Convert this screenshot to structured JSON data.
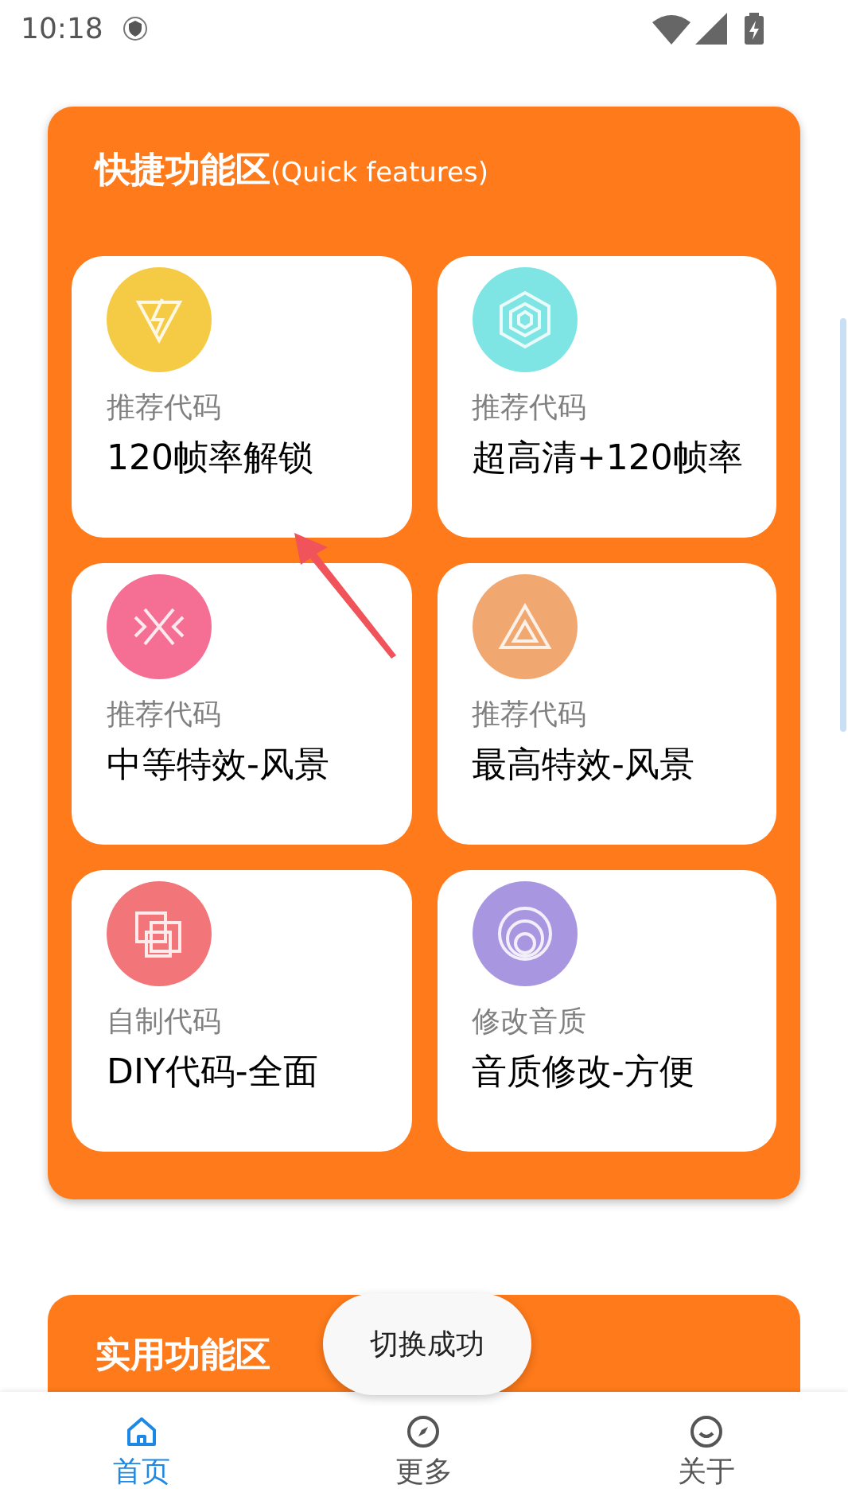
{
  "status_bar": {
    "time": "10:18"
  },
  "quick_section": {
    "title": "快捷功能区",
    "subtitle": "(Quick features)",
    "tiles": [
      {
        "kind": "bolt",
        "color": "#f5cb45",
        "label": "推荐代码",
        "title": "120帧率解锁"
      },
      {
        "kind": "hexagon",
        "color": "#7ee5e4",
        "label": "推荐代码",
        "title": "超高清+120帧率"
      },
      {
        "kind": "cross",
        "color": "#f56e94",
        "label": "推荐代码",
        "title": "中等特效-风景"
      },
      {
        "kind": "triangle",
        "color": "#f0a770",
        "label": "推荐代码",
        "title": "最高特效-风景"
      },
      {
        "kind": "squares",
        "color": "#f27679",
        "label": "自制代码",
        "title": "DIY代码-全面"
      },
      {
        "kind": "rings",
        "color": "#a996e0",
        "label": "修改音质",
        "title": "音质修改-方便"
      }
    ]
  },
  "utility_section": {
    "title": "实用功能区"
  },
  "toast": "切换成功",
  "bottom_nav": [
    {
      "kind": "home",
      "label": "首页",
      "selected": true
    },
    {
      "kind": "compass",
      "label": "更多",
      "selected": false
    },
    {
      "kind": "face",
      "label": "关于",
      "selected": false
    }
  ]
}
